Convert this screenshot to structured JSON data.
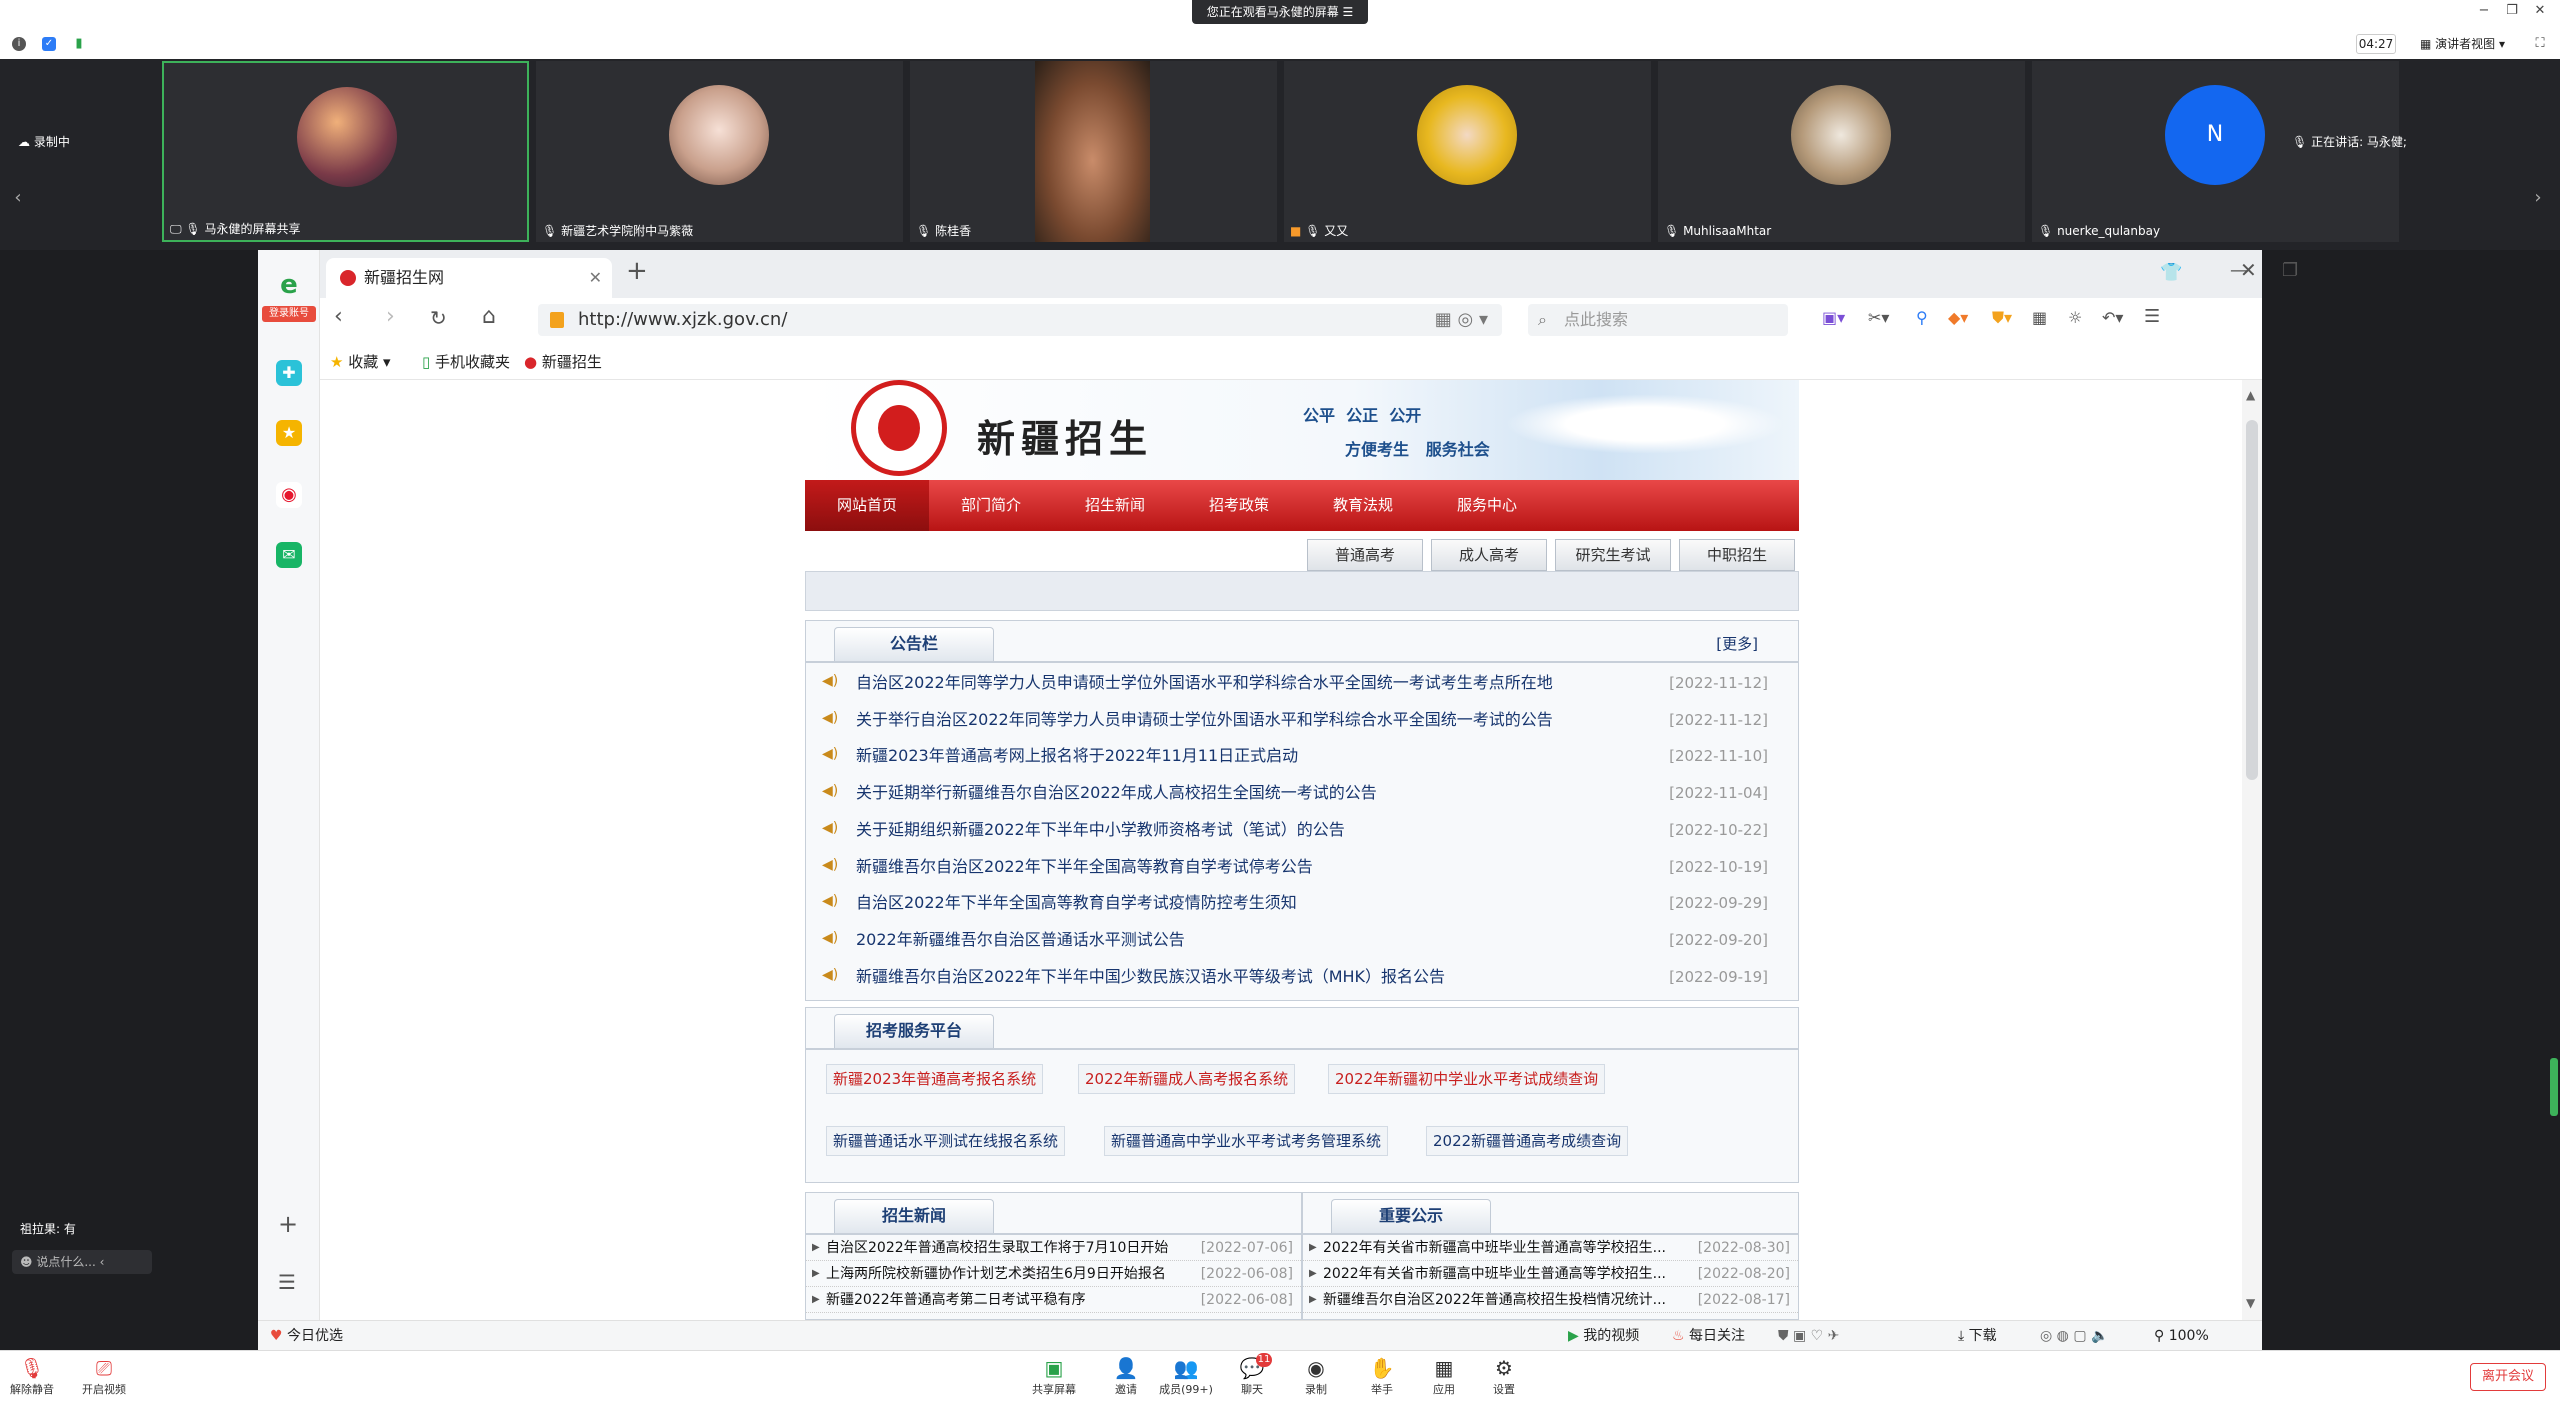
{
  "meeting": {
    "share_banner": "您正在观看马永健的屏幕",
    "timer": "04:27",
    "view_mode": "演讲者视图",
    "recording": "录制中",
    "speaking": "正在讲话: 马永健;",
    "participants": [
      {
        "name": "马永健的屏幕共享"
      },
      {
        "name": "新疆艺术学院附中马紫薇"
      },
      {
        "name": "陈桂香"
      },
      {
        "name": "又又"
      },
      {
        "name": "MuhlisaaMhtar"
      },
      {
        "name": "nuerke_qulanbay",
        "initial": "N"
      }
    ],
    "chat_name": "祖拉果: 有",
    "chat_placeholder": "说点什么...",
    "toolbar": {
      "mute": "解除静音",
      "video": "开启视频",
      "share": "共享屏幕",
      "invite": "邀请",
      "members": "成员(99+)",
      "chat": "聊天",
      "chat_badge": "11",
      "record": "录制",
      "hand": "举手",
      "apps": "应用",
      "settings": "设置",
      "leave": "离开会议"
    }
  },
  "browser": {
    "login_label": "登录账号",
    "tab_title": "新疆招生网",
    "url": "http://www.xjzk.gov.cn/",
    "search_placeholder": "点此搜索",
    "bookmarks": [
      "收藏",
      "手机收藏夹",
      "新疆招生"
    ],
    "status_left": "今日优选",
    "status_items": [
      "我的视频",
      "每日关注",
      "下载"
    ],
    "zoom": "100%"
  },
  "site": {
    "logo_text": "新疆招生",
    "slogan1": "公平  公正  公开",
    "slogan2": "方便考生   服务社会",
    "nav": [
      "网站首页",
      "部门简介",
      "招生新闻",
      "招考政策",
      "教育法规",
      "服务中心"
    ],
    "subtabs": [
      "普通高考",
      "成人高考",
      "研究生考试",
      "中职招生"
    ],
    "notice": {
      "title": "公告栏",
      "more": "[更多]",
      "items": [
        {
          "title": "自治区2022年同等学力人员申请硕士学位外国语水平和学科综合水平全国统一考试考生考点所在地",
          "date": "[2022-11-12]"
        },
        {
          "title": "关于举行自治区2022年同等学力人员申请硕士学位外国语水平和学科综合水平全国统一考试的公告",
          "date": "[2022-11-12]"
        },
        {
          "title": "新疆2023年普通高考网上报名将于2022年11月11日正式启动",
          "date": "[2022-11-10]"
        },
        {
          "title": "关于延期举行新疆维吾尔自治区2022年成人高校招生全国统一考试的公告",
          "date": "[2022-11-04]"
        },
        {
          "title": "关于延期组织新疆2022年下半年中小学教师资格考试（笔试）的公告",
          "date": "[2022-10-22]"
        },
        {
          "title": "新疆维吾尔自治区2022年下半年全国高等教育自学考试停考公告",
          "date": "[2022-10-19]"
        },
        {
          "title": "自治区2022年下半年全国高等教育自学考试疫情防控考生须知",
          "date": "[2022-09-29]"
        },
        {
          "title": "2022年新疆维吾尔自治区普通话水平测试公告",
          "date": "[2022-09-20]"
        },
        {
          "title": "新疆维吾尔自治区2022年下半年中国少数民族汉语水平等级考试（MHK）报名公告",
          "date": "[2022-09-19]"
        }
      ]
    },
    "platform": {
      "title": "招考服务平台",
      "row1": [
        "新疆2023年普通高考报名系统",
        "2022年新疆成人高考报名系统",
        "2022年新疆初中学业水平考试成绩查询"
      ],
      "row2": [
        "新疆普通话水平测试在线报名系统",
        "新疆普通高中学业水平考试考务管理系统",
        "2022新疆普通高考成绩查询"
      ]
    },
    "news": {
      "title": "招生新闻",
      "items": [
        {
          "title": "自治区2022年普通高校招生录取工作将于7月10日开始",
          "date": "[2022-07-06]"
        },
        {
          "title": "上海两所院校新疆协作计划艺术类招生6月9日开始报名",
          "date": "[2022-06-08]"
        },
        {
          "title": "新疆2022年普通高考第二日考试平稳有序",
          "date": "[2022-06-08]"
        }
      ]
    },
    "important": {
      "title": "重要公示",
      "items": [
        {
          "title": "2022年有关省市新疆高中班毕业生普通高等学校招生...",
          "date": "[2022-08-30]"
        },
        {
          "title": "2022年有关省市新疆高中班毕业生普通高等学校招生...",
          "date": "[2022-08-20]"
        },
        {
          "title": "新疆维吾尔自治区2022年普通高校招生投档情况统计...",
          "date": "[2022-08-17]"
        }
      ]
    }
  }
}
